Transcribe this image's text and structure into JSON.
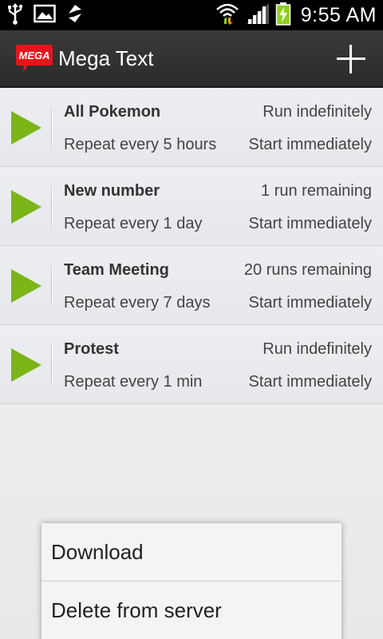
{
  "status_bar": {
    "time": "9:55 AM",
    "icons": [
      "usb-icon",
      "image-icon",
      "sync-icon",
      "wifi-icon",
      "signal-icon",
      "battery-charging-icon"
    ]
  },
  "action_bar": {
    "title": "Mega Text",
    "logo_text": "MEGA",
    "add_icon": "plus-icon"
  },
  "colors": {
    "play_green": "#7cb518",
    "logo_red": "#e5161b",
    "actionbar": "#333333"
  },
  "schedules": [
    {
      "name": "All Pokemon",
      "remaining": "Run indefinitely",
      "repeat": "Repeat every 5 hours",
      "start": "Start immediately"
    },
    {
      "name": "New number",
      "remaining": "1 run remaining",
      "repeat": "Repeat every 1 day",
      "start": "Start immediately"
    },
    {
      "name": "Team Meeting",
      "remaining": "20 runs remaining",
      "repeat": "Repeat every 7 days",
      "start": "Start immediately"
    },
    {
      "name": "Protest",
      "remaining": "Run indefinitely",
      "repeat": "Repeat every 1 min",
      "start": "Start immediately"
    }
  ],
  "context_menu": {
    "items": [
      "Download",
      "Delete from server"
    ]
  }
}
